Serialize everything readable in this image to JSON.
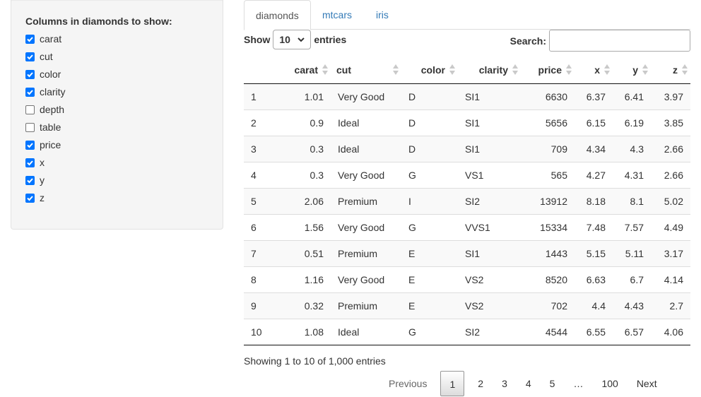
{
  "sidebar": {
    "title": "Columns in diamonds to show:",
    "options": [
      {
        "label": "carat",
        "checked": true
      },
      {
        "label": "cut",
        "checked": true
      },
      {
        "label": "color",
        "checked": true
      },
      {
        "label": "clarity",
        "checked": true
      },
      {
        "label": "depth",
        "checked": false
      },
      {
        "label": "table",
        "checked": false
      },
      {
        "label": "price",
        "checked": true
      },
      {
        "label": "x",
        "checked": true
      },
      {
        "label": "y",
        "checked": true
      },
      {
        "label": "z",
        "checked": true
      }
    ]
  },
  "tabs": [
    {
      "label": "diamonds",
      "active": true
    },
    {
      "label": "mtcars",
      "active": false
    },
    {
      "label": "iris",
      "active": false
    }
  ],
  "length": {
    "show": "Show",
    "value": "10",
    "entries": "entries"
  },
  "search": {
    "label": "Search:",
    "value": ""
  },
  "table": {
    "headers": [
      "",
      "carat",
      "cut",
      "color",
      "clarity",
      "price",
      "x",
      "y",
      "z"
    ],
    "rows": [
      [
        "1",
        "1.01",
        "Very Good",
        "D",
        "SI1",
        "6630",
        "6.37",
        "6.41",
        "3.97"
      ],
      [
        "2",
        "0.9",
        "Ideal",
        "D",
        "SI1",
        "5656",
        "6.15",
        "6.19",
        "3.85"
      ],
      [
        "3",
        "0.3",
        "Ideal",
        "D",
        "SI1",
        "709",
        "4.34",
        "4.3",
        "2.66"
      ],
      [
        "4",
        "0.3",
        "Very Good",
        "G",
        "VS1",
        "565",
        "4.27",
        "4.31",
        "2.66"
      ],
      [
        "5",
        "2.06",
        "Premium",
        "I",
        "SI2",
        "13912",
        "8.18",
        "8.1",
        "5.02"
      ],
      [
        "6",
        "1.56",
        "Very Good",
        "G",
        "VVS1",
        "15334",
        "7.48",
        "7.57",
        "4.49"
      ],
      [
        "7",
        "0.51",
        "Premium",
        "E",
        "SI1",
        "1443",
        "5.15",
        "5.11",
        "3.17"
      ],
      [
        "8",
        "1.16",
        "Very Good",
        "E",
        "VS2",
        "8520",
        "6.63",
        "6.7",
        "4.14"
      ],
      [
        "9",
        "0.32",
        "Premium",
        "E",
        "VS2",
        "702",
        "4.4",
        "4.43",
        "2.7"
      ],
      [
        "10",
        "1.08",
        "Ideal",
        "G",
        "SI2",
        "4544",
        "6.55",
        "6.57",
        "4.06"
      ]
    ]
  },
  "info": "Showing 1 to 10 of 1,000 entries",
  "pagination": {
    "previous": "Previous",
    "pages": [
      "1",
      "2",
      "3",
      "4",
      "5",
      "…",
      "100"
    ],
    "current": "1",
    "next": "Next"
  },
  "colors": {
    "link": "#337ab7",
    "checkbox": "#0075ff",
    "stripe": "#f9f9f9"
  }
}
